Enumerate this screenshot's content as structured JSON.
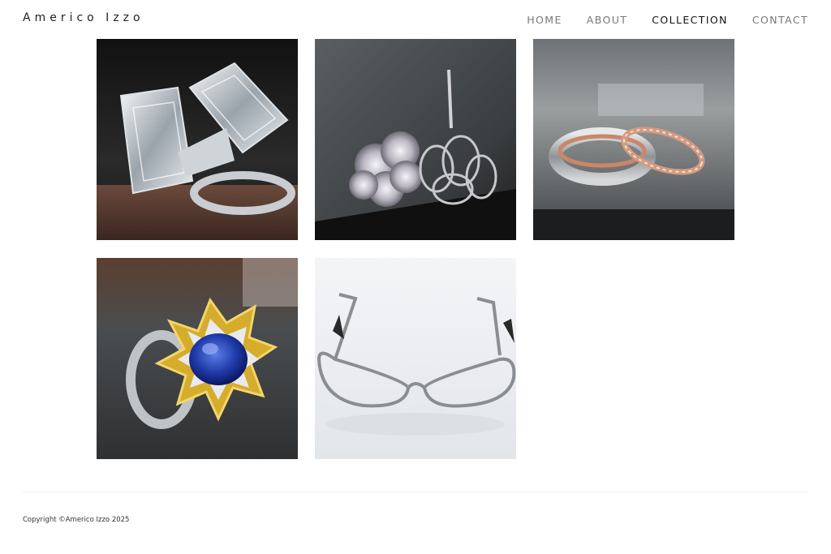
{
  "site": {
    "title": "Americo Izzo"
  },
  "nav": {
    "items": [
      "HOME",
      "ABOUT",
      "COLLECTION",
      "CONTACT"
    ],
    "active": "COLLECTION"
  },
  "gallery": {
    "items": [
      {
        "icon": "emerald-cut-diamond-ring-photo"
      },
      {
        "icon": "diamond-flower-earrings-photo"
      },
      {
        "icon": "rose-gold-wedding-bands-photo"
      },
      {
        "icon": "sapphire-cocktail-ring-photo"
      },
      {
        "icon": "silver-eyeglasses-photo"
      }
    ]
  },
  "footer": {
    "copyright": "Copyright ©Americo Izzo 2025"
  },
  "colors": {
    "nav_inactive": "#777777",
    "nav_active": "#111111",
    "background": "#ffffff"
  }
}
